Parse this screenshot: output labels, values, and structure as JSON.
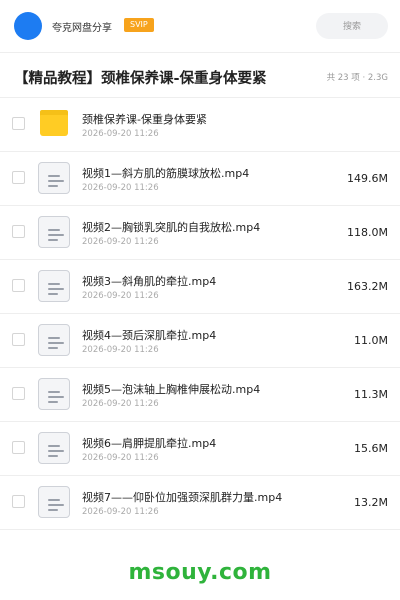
{
  "header": {
    "username": "夸克网盘分享",
    "badge": "SVIP",
    "search_label": "搜索",
    "avatar_color": "#1d7cf2",
    "badge_color": "#f7a31c"
  },
  "share": {
    "title": "【精品教程】颈椎保养课-保重身体要紧",
    "meta": "共 23 项 · 2.3G"
  },
  "files": [
    {
      "type": "folder",
      "name": "颈椎保养课-保重身体要紧",
      "date": "2026-09-20 11:26",
      "size": ""
    },
    {
      "type": "file",
      "name": "视频1—斜方肌的筋膜球放松.mp4",
      "date": "2026-09-20 11:26",
      "size": "149.6M"
    },
    {
      "type": "file",
      "name": "视频2—胸锁乳突肌的自我放松.mp4",
      "date": "2026-09-20 11:26",
      "size": "118.0M"
    },
    {
      "type": "file",
      "name": "视频3—斜角肌的牵拉.mp4",
      "date": "2026-09-20 11:26",
      "size": "163.2M"
    },
    {
      "type": "file",
      "name": "视频4—颈后深肌牵拉.mp4",
      "date": "2026-09-20 11:26",
      "size": "11.0M"
    },
    {
      "type": "file",
      "name": "视频5—泡沫轴上胸椎伸展松动.mp4",
      "date": "2026-09-20 11:26",
      "size": "11.3M"
    },
    {
      "type": "file",
      "name": "视频6—肩胛提肌牵拉.mp4",
      "date": "2026-09-20 11:26",
      "size": "15.6M"
    },
    {
      "type": "file",
      "name": "视频7——仰卧位加强颈深肌群力量.mp4",
      "date": "2026-09-20 11:26",
      "size": "13.2M"
    }
  ],
  "watermark": "msouy.com",
  "watermark_color": "#2fb33b"
}
